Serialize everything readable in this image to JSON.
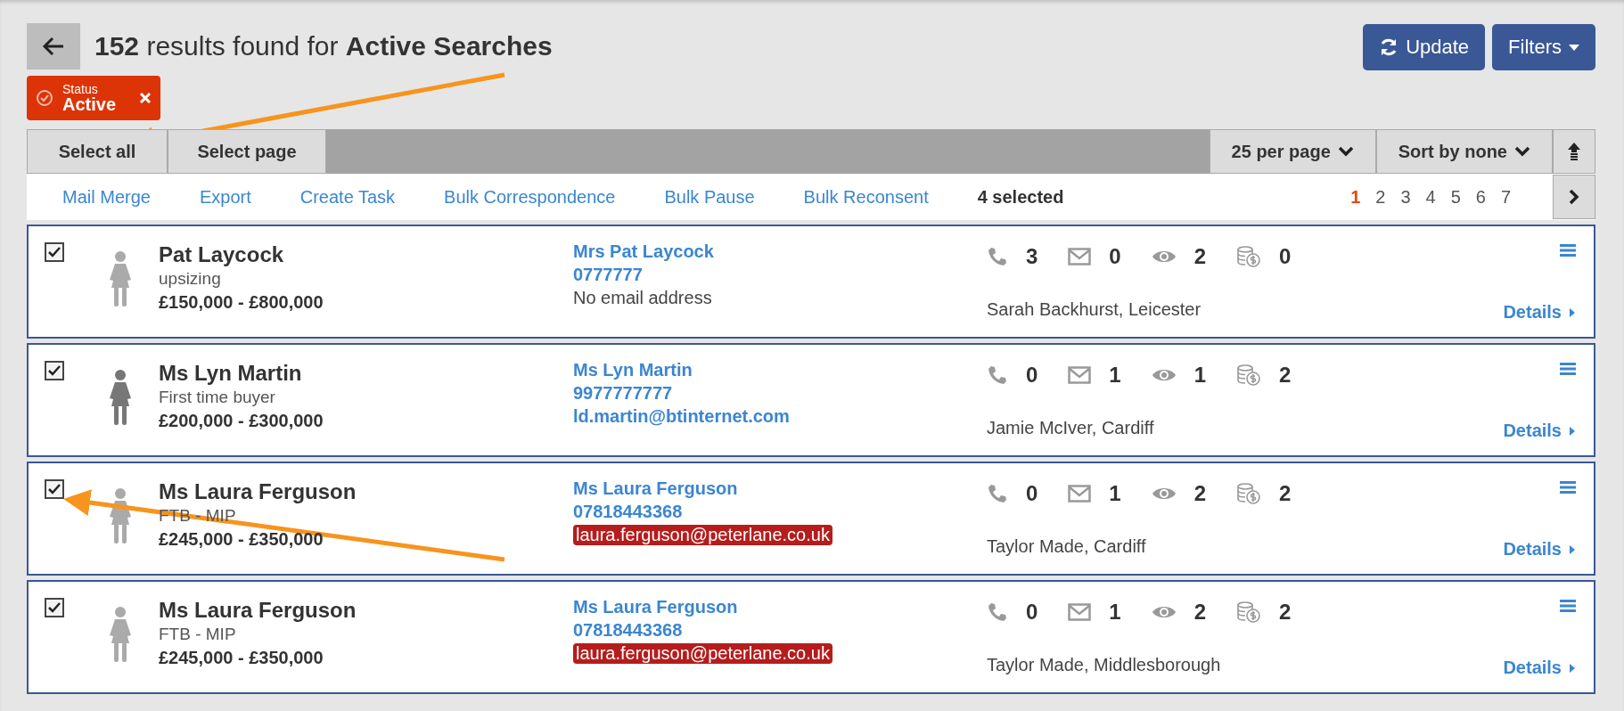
{
  "header": {
    "count": "152",
    "title": "results found for",
    "query": "Active Searches"
  },
  "buttons": [
    {
      "kind": "update",
      "label": "Update"
    },
    {
      "kind": "filters",
      "label": "Filters"
    }
  ],
  "filter_chip": {
    "label": "Status",
    "value": "Active"
  },
  "toolbar": {
    "left": [
      "Select all",
      "Select page"
    ],
    "per_page": "25 per page",
    "sort": "Sort by none"
  },
  "actions": [
    "Mail Merge",
    "Export",
    "Create Task",
    "Bulk Correspondence",
    "Bulk Pause",
    "Bulk Reconsent"
  ],
  "selected_count": "4 selected",
  "pages": [
    {
      "label": "1",
      "selected": true
    },
    {
      "label": "2",
      "selected": false
    },
    {
      "label": "3",
      "selected": false
    },
    {
      "label": "4",
      "selected": false
    },
    {
      "label": "5",
      "selected": false
    },
    {
      "label": "6",
      "selected": false
    },
    {
      "label": "7",
      "selected": false
    }
  ],
  "results": [
    {
      "checked": true,
      "color": "#aaaaaa",
      "name": "Pat Laycock",
      "type": "upsizing",
      "price": "£150,000 - £800,000",
      "contact_name": "Mrs Pat Laycock",
      "phone": "0777777",
      "email": "No email address",
      "kind": "none",
      "stats": [
        {
          "kind": "calls",
          "count": "3"
        },
        {
          "kind": "emails",
          "count": "0"
        },
        {
          "kind": "views",
          "count": "2"
        },
        {
          "kind": "offers",
          "count": "0"
        }
      ],
      "location": "Sarah Backhurst, Leicester",
      "details": "Details"
    },
    {
      "checked": true,
      "color": "#777777",
      "name": "Ms Lyn Martin",
      "type": "First time buyer",
      "price": "£200,000 - £300,000",
      "contact_name": "Ms Lyn Martin",
      "phone": "9977777777",
      "email": "ld.martin@btinternet.com",
      "kind": "link",
      "stats": [
        {
          "kind": "calls",
          "count": "0"
        },
        {
          "kind": "emails",
          "count": "1"
        },
        {
          "kind": "views",
          "count": "1"
        },
        {
          "kind": "offers",
          "count": "2"
        }
      ],
      "location": "Jamie McIver, Cardiff",
      "details": "Details"
    },
    {
      "checked": true,
      "color": "#aaaaaa",
      "name": "Ms Laura Ferguson",
      "type": "FTB - MIP",
      "price": "£245,000 - £350,000",
      "contact_name": "Ms Laura Ferguson",
      "phone": "07818443368",
      "email": "laura.ferguson@peterlane.co.uk",
      "kind": "flagged",
      "stats": [
        {
          "kind": "calls",
          "count": "0"
        },
        {
          "kind": "emails",
          "count": "1"
        },
        {
          "kind": "views",
          "count": "2"
        },
        {
          "kind": "offers",
          "count": "2"
        }
      ],
      "location": "Taylor Made, Cardiff",
      "details": "Details"
    },
    {
      "checked": true,
      "color": "#aaaaaa",
      "name": "Ms Laura Ferguson",
      "type": "FTB - MIP",
      "price": "£245,000 - £350,000",
      "contact_name": "Ms Laura Ferguson",
      "phone": "07818443368",
      "email": "laura.ferguson@peterlane.co.uk",
      "kind": "flagged",
      "stats": [
        {
          "kind": "calls",
          "count": "0"
        },
        {
          "kind": "emails",
          "count": "1"
        },
        {
          "kind": "views",
          "count": "2"
        },
        {
          "kind": "offers",
          "count": "2"
        }
      ],
      "location": "Taylor Made, Middlesborough",
      "details": "Details"
    }
  ]
}
